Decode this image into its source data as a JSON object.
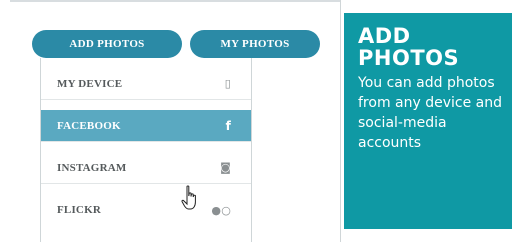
{
  "tabs": {
    "add_photos": "ADD PHOTOS",
    "my_photos": "MY PHOTOS"
  },
  "menu": {
    "items": [
      {
        "label": "MY DEVICE",
        "icon": "phone-icon",
        "glyph": "▯",
        "active": false
      },
      {
        "label": "FACEBOOK",
        "icon": "facebook-icon",
        "glyph": "f",
        "active": true
      },
      {
        "label": "INSTAGRAM",
        "icon": "instagram-icon",
        "glyph": "◙",
        "active": false
      },
      {
        "label": "FLICKR",
        "icon": "flickr-icon",
        "glyph": "●○",
        "active": false
      }
    ]
  },
  "panel": {
    "title": "ADD PHOTOS",
    "text": "You can add photos from any device and social-media accounts"
  },
  "colors": {
    "tab": "#2b8aa6",
    "active_item": "#5aa9c1",
    "panel": "#0f99a4"
  }
}
